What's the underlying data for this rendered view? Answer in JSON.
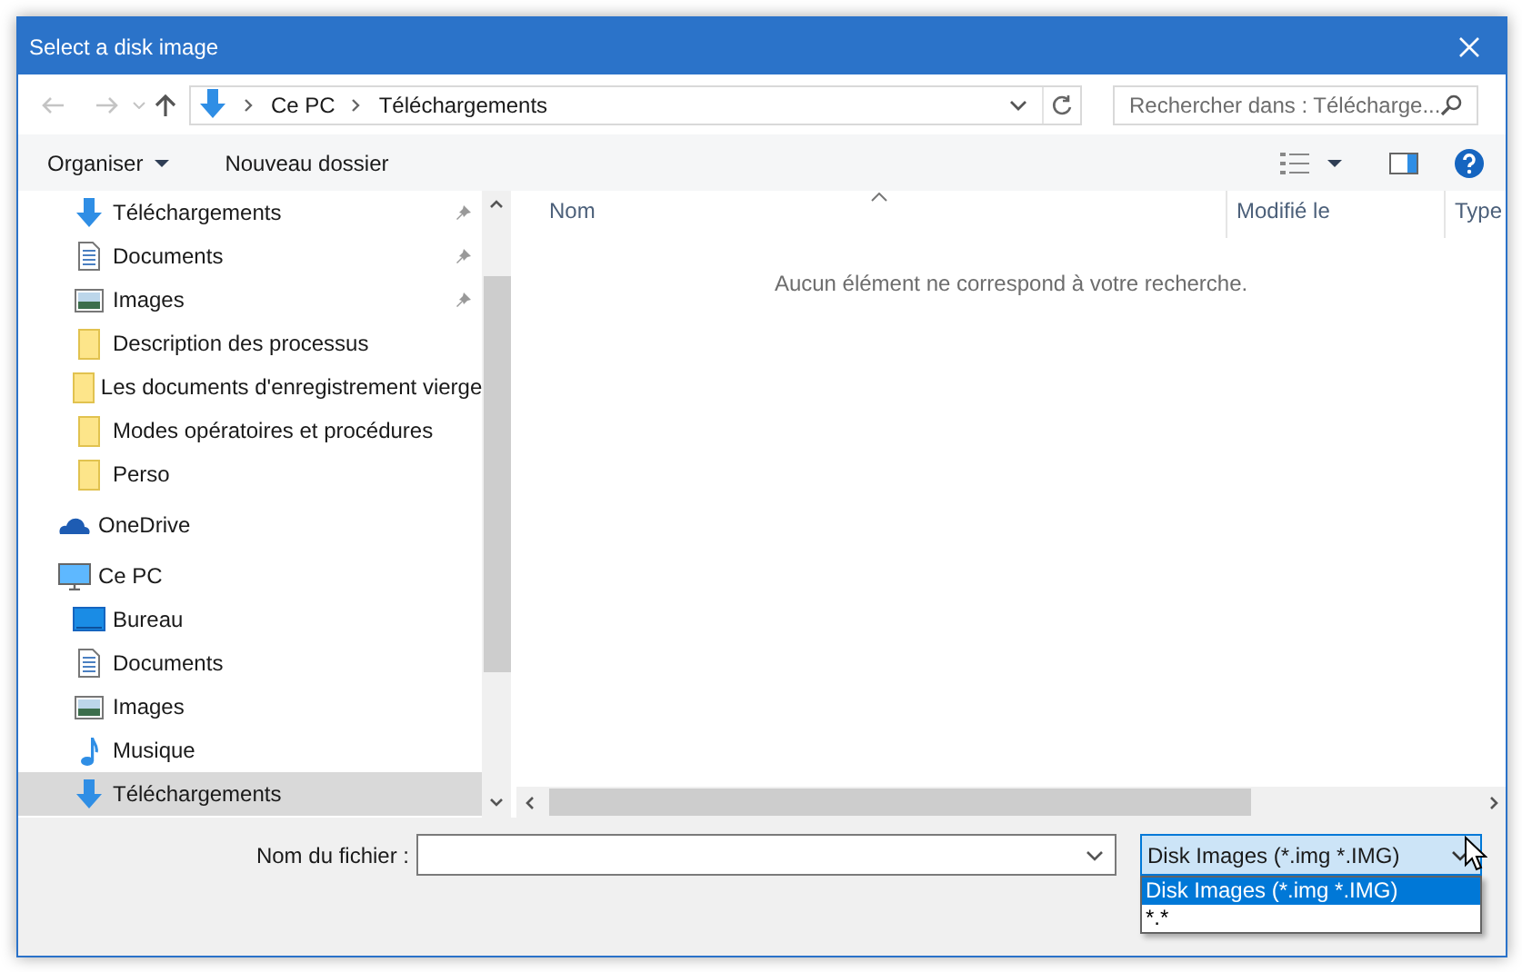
{
  "window": {
    "title": "Select a disk image"
  },
  "address_bar": {
    "path": [
      {
        "label": "Ce PC"
      },
      {
        "label": "Téléchargements"
      }
    ]
  },
  "search": {
    "placeholder": "Rechercher dans : Télécharge..."
  },
  "toolbar": {
    "organize": "Organiser",
    "new_folder": "Nouveau dossier"
  },
  "nav": {
    "quick_access": [
      {
        "label": "Téléchargements",
        "kind": "download",
        "pinned": true,
        "selected": false
      },
      {
        "label": "Documents",
        "kind": "document",
        "pinned": true,
        "selected": false
      },
      {
        "label": "Images",
        "kind": "image",
        "pinned": true,
        "selected": false
      },
      {
        "label": "Description des processus",
        "kind": "folder",
        "pinned": false,
        "selected": false
      },
      {
        "label": "Les documents d'enregistrement vierge",
        "kind": "folder",
        "pinned": false,
        "selected": false
      },
      {
        "label": "Modes opératoires et procédures",
        "kind": "folder",
        "pinned": false,
        "selected": false
      },
      {
        "label": "Perso",
        "kind": "folder",
        "pinned": false,
        "selected": false
      }
    ],
    "locations": [
      {
        "label": "OneDrive",
        "kind": "cloud",
        "selected": false
      },
      {
        "label": "Ce PC",
        "kind": "pc",
        "selected": false,
        "children": [
          {
            "label": "Bureau",
            "kind": "desktop",
            "selected": false
          },
          {
            "label": "Documents",
            "kind": "document",
            "selected": false
          },
          {
            "label": "Images",
            "kind": "image",
            "selected": false
          },
          {
            "label": "Musique",
            "kind": "music",
            "selected": false
          },
          {
            "label": "Téléchargements",
            "kind": "download",
            "selected": true
          }
        ]
      }
    ]
  },
  "file_list": {
    "columns": [
      {
        "label": "Nom",
        "sorted": true
      },
      {
        "label": "Modifié le",
        "sorted": false
      },
      {
        "label": "Type",
        "sorted": false
      }
    ],
    "empty_message": "Aucun élément ne correspond à votre recherche."
  },
  "footer": {
    "filename_label": "Nom du fichier :",
    "filter": {
      "value": "Disk Images (*.img *.IMG)",
      "expanded": true,
      "options": [
        {
          "label": "Disk Images (*.img *.IMG)",
          "selected": true
        },
        {
          "label": "*.*",
          "selected": false
        }
      ]
    }
  }
}
